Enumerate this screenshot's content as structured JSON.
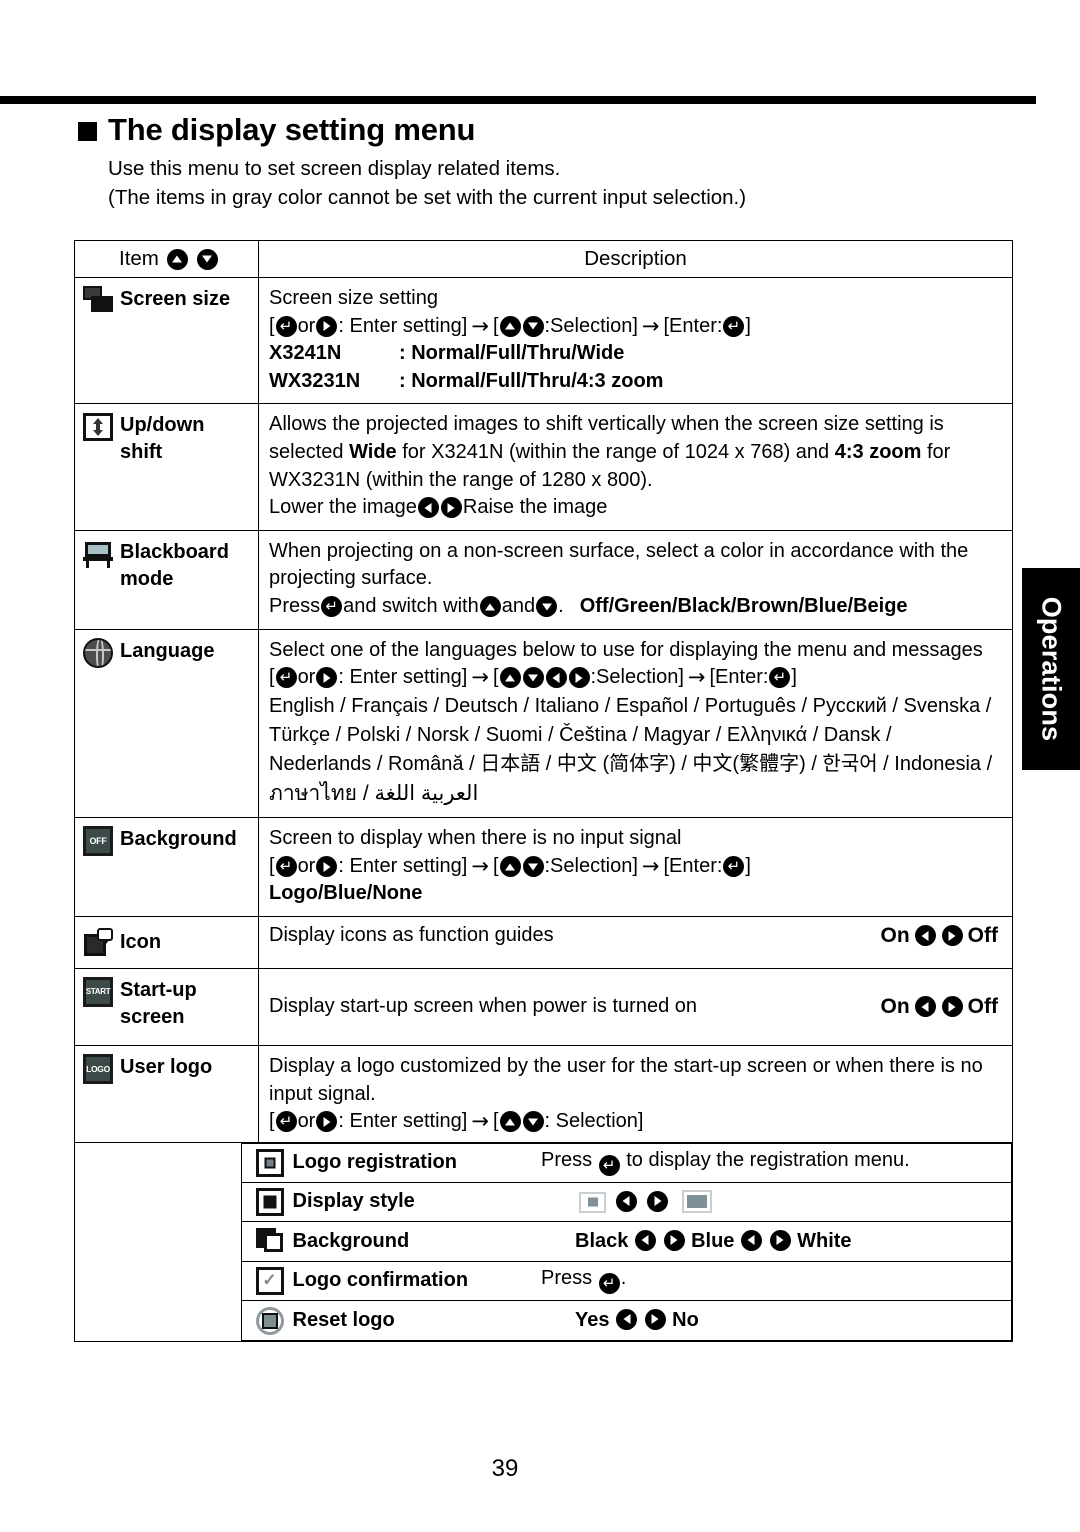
{
  "page": {
    "number": "39",
    "side_tab_label": "Operations"
  },
  "heading": {
    "title": "The display setting menu",
    "intro_line_1": "Use this menu to set screen display related items.",
    "intro_line_2": "(The items in gray color cannot be set with the current input selection.)"
  },
  "table": {
    "header": {
      "item": "Item",
      "description": "Description"
    },
    "rows": [
      {
        "icon": "screen-size-icon",
        "label": "Screen size",
        "desc_line_1": "Screen size setting",
        "nav_prefix": "[",
        "nav_or": " or ",
        "nav_enter_setting": ": Enter setting] ",
        "nav_selection": ":Selection] ",
        "nav_enter": "[Enter: ",
        "nav_close": "]",
        "model_1": "X3241N",
        "model_1_value": ": Normal/Full/Thru/Wide",
        "model_2": "WX3231N",
        "model_2_value": ": Normal/Full/Thru/4:3 zoom"
      },
      {
        "icon": "up-down-shift-icon",
        "label_line_1": "Up/down",
        "label_line_2": "shift",
        "desc_a": "Allows the projected images to shift vertically when the screen size setting is",
        "desc_b_pre": "selected ",
        "desc_b_bold1": "Wide",
        "desc_b_mid": " for X3241N (within the range of 1024 x 768) and ",
        "desc_b_bold2": "4:3 zoom",
        "desc_b_post": " for",
        "desc_c": "WX3231N (within the range of 1280 x 800).",
        "desc_d_pre": "Lower the image ",
        "desc_d_post": " Raise the image"
      },
      {
        "icon": "blackboard-icon",
        "label_line_1": "Blackboard",
        "label_line_2": "mode",
        "desc_a": "When projecting on a non-screen surface, select a color in accordance with the",
        "desc_b": "projecting surface.",
        "desc_c_press": "Press ",
        "desc_c_mid": " and switch with ",
        "desc_c_and": " and ",
        "desc_c_dot": ".",
        "desc_c_values": "Off/Green/Black/Brown/Blue/Beige"
      },
      {
        "icon": "language-globe-icon",
        "label": "Language",
        "desc_a": "Select one of the languages below to use for displaying the menu and messages",
        "lang_line_1": "English / Français / Deutsch / Italiano / Español / Português / Русский / Svenska /",
        "lang_line_2": "Türkçe / Polski / Norsk / Suomi / Čeština / Magyar / Ελληνικά / Dansk /",
        "lang_line_3": "Nederlands / Română / 日本語 / 中文 (简体字) / 中文(繁體字) / 한국어 / Indonesia /",
        "lang_line_4": "ภาษาไทย / العربية اللغة"
      },
      {
        "icon": "background-off-icon",
        "label": "Background",
        "desc_a": "Screen to display when there is no input signal",
        "values": "Logo/Blue/None"
      },
      {
        "icon": "function-guide-icon",
        "label": "Icon",
        "desc_a": "Display icons as function guides",
        "opt_on": "On",
        "opt_off": "Off"
      },
      {
        "icon": "start-up-screen-icon",
        "label_line_1": "Start-up",
        "label_line_2": "screen",
        "desc_a": "Display start-up screen when power is turned on",
        "opt_on": "On",
        "opt_off": "Off"
      },
      {
        "icon": "user-logo-icon",
        "label": "User logo",
        "desc_a": "Display a logo customized by the user for the start-up screen or when there is no",
        "desc_b": "input signal.",
        "nav_selection_only": ": Selection]"
      }
    ],
    "sub_rows": [
      {
        "icon": "logo-registration-icon",
        "label": "Logo registration",
        "desc_pre": "Press ",
        "desc_post": " to display the registration menu."
      },
      {
        "icon": "display-style-icon",
        "label": "Display style",
        "style_small": "small-logo-thumbnail",
        "style_large": "full-logo-thumbnail"
      },
      {
        "icon": "logo-background-icon",
        "label": "Background",
        "opt_1": "Black",
        "opt_2": "Blue",
        "opt_3": "White"
      },
      {
        "icon": "logo-confirmation-icon",
        "label": "Logo confirmation",
        "desc_pre": "Press ",
        "desc_post": "."
      },
      {
        "icon": "reset-logo-icon",
        "label": "Reset logo",
        "opt_yes": "Yes",
        "opt_no": "No"
      }
    ]
  },
  "glyphs": {
    "enter_key": "enter-key-icon",
    "up_key": "up-arrow-key-icon",
    "down_key": "down-arrow-key-icon",
    "left_key": "left-arrow-key-icon",
    "right_key": "right-arrow-key-icon",
    "flow_arrow": "→"
  },
  "colors": {
    "text": "#000000",
    "rule": "#000000",
    "tab_background": "#000000",
    "tab_text": "#ffffff",
    "icon_accent": "#7d9196"
  }
}
